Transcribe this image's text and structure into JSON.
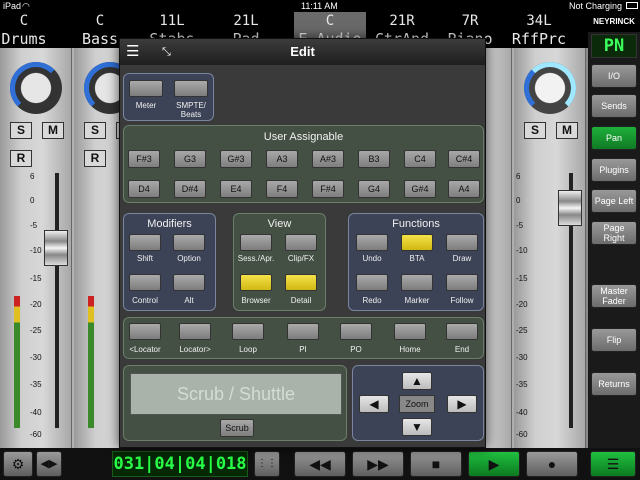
{
  "status": {
    "device": "iPad",
    "time": "11:11 AM",
    "battery": "Not Charging"
  },
  "channels": [
    {
      "pan": "C",
      "name": "Drums"
    },
    {
      "pan": "C",
      "name": "Bass"
    },
    {
      "pan": "11L",
      "name": "Stabs"
    },
    {
      "pan": "21L",
      "name": "Pad"
    },
    {
      "pan": "C",
      "name": "E.Audio"
    },
    {
      "pan": "21R",
      "name": "CtrAnd"
    },
    {
      "pan": "7R",
      "name": "Piano"
    },
    {
      "pan": "34L",
      "name": "RffPrc"
    }
  ],
  "strip": {
    "solo": "S",
    "mute": "M",
    "rec": "R",
    "scale": [
      "6",
      "0",
      "-5",
      "-10",
      "-15",
      "-20",
      "-25",
      "-30",
      "-35",
      "-40",
      "-60"
    ]
  },
  "right": {
    "brand": "NEYRINCK",
    "mode": "PN",
    "buttons": [
      "I/O",
      "Sends",
      "Pan",
      "Plugins",
      "Page Left",
      "Page Right",
      "Master Fader",
      "Flip",
      "Returns"
    ],
    "active": "Pan"
  },
  "edit": {
    "title": "Edit",
    "meter": "Meter",
    "smpte": "SMPTE/ Beats",
    "user_title": "User Assignable",
    "user_row1": [
      "F#3",
      "G3",
      "G#3",
      "A3",
      "A#3",
      "B3",
      "C4",
      "C#4"
    ],
    "user_row2": [
      "D4",
      "D#4",
      "E4",
      "F4",
      "F#4",
      "G4",
      "G#4",
      "A4"
    ],
    "modifiers": {
      "title": "Modifiers",
      "items": [
        "Shift",
        "Option",
        "Control",
        "Alt"
      ]
    },
    "view": {
      "title": "View",
      "items": [
        "Sess./Apr.",
        "Clip/FX",
        "Browser",
        "Detail"
      ]
    },
    "functions": {
      "title": "Functions",
      "items": [
        "Undo",
        "BTA",
        "Draw",
        "Redo",
        "Marker",
        "Follow"
      ]
    },
    "locators": [
      "<Locator",
      "Locator>",
      "Loop",
      "PI",
      "PO",
      "Home",
      "End"
    ],
    "scrub_display": "Scrub / Shuttle",
    "scrub_button": "Scrub",
    "zoom": "Zoom"
  },
  "transport": {
    "counter": "031|04|04|018"
  },
  "colors": {
    "accent_green": "#1fb03c",
    "highlight_yellow": "#f4e24a",
    "counter_green": "#28ff48"
  }
}
